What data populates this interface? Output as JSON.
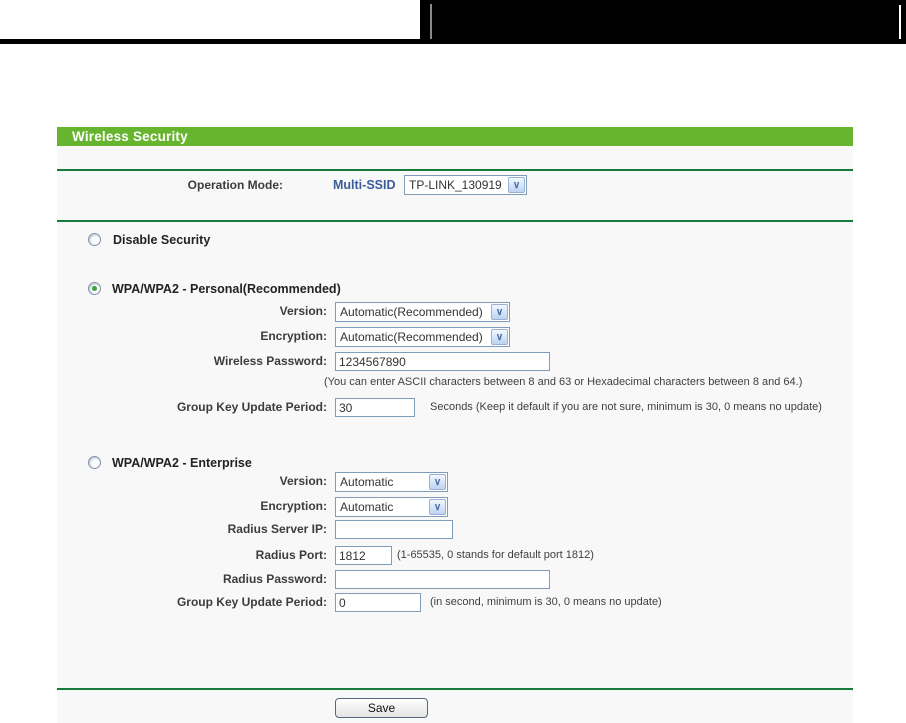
{
  "icons": {
    "chevron_down": "∨"
  },
  "header": {
    "title": "Wireless Security"
  },
  "operation_mode": {
    "label": "Operation Mode:",
    "mode_value": "Multi-SSID",
    "ssid_selected": "TP-LINK_130919"
  },
  "security_options": {
    "disable": {
      "label": "Disable Security"
    },
    "personal": {
      "title": "WPA/WPA2 - Personal(Recommended)",
      "version": {
        "label": "Version:",
        "value": "Automatic(Recommended)"
      },
      "encryption": {
        "label": "Encryption:",
        "value": "Automatic(Recommended)"
      },
      "password": {
        "label": "Wireless Password:",
        "value": "1234567890",
        "note": "(You can enter ASCII characters between 8 and 63 or Hexadecimal characters between 8 and 64.)"
      },
      "group_key": {
        "label": "Group Key Update Period:",
        "value": "30",
        "note": "Seconds (Keep it default if you are not sure, minimum is 30, 0 means no update)"
      }
    },
    "enterprise": {
      "title": "WPA/WPA2 - Enterprise",
      "version": {
        "label": "Version:",
        "value": "Automatic"
      },
      "encryption": {
        "label": "Encryption:",
        "value": "Automatic"
      },
      "radius_ip": {
        "label": "Radius Server IP:",
        "value": ""
      },
      "radius_port": {
        "label": "Radius Port:",
        "value": "1812",
        "note": "(1-65535, 0 stands for default port 1812)"
      },
      "radius_password": {
        "label": "Radius Password:",
        "value": ""
      },
      "group_key": {
        "label": "Group Key Update Period:",
        "value": "0",
        "note": "(in second, minimum is 30, 0 means no update)"
      }
    }
  },
  "footer": {
    "save_label": "Save"
  },
  "colors": {
    "header_green": "#67b42f",
    "separator_green": "#157a3a",
    "accent_blue": "#3a5c9d",
    "input_border": "#7f9db9",
    "panel_bg": "#f8f8f8"
  }
}
